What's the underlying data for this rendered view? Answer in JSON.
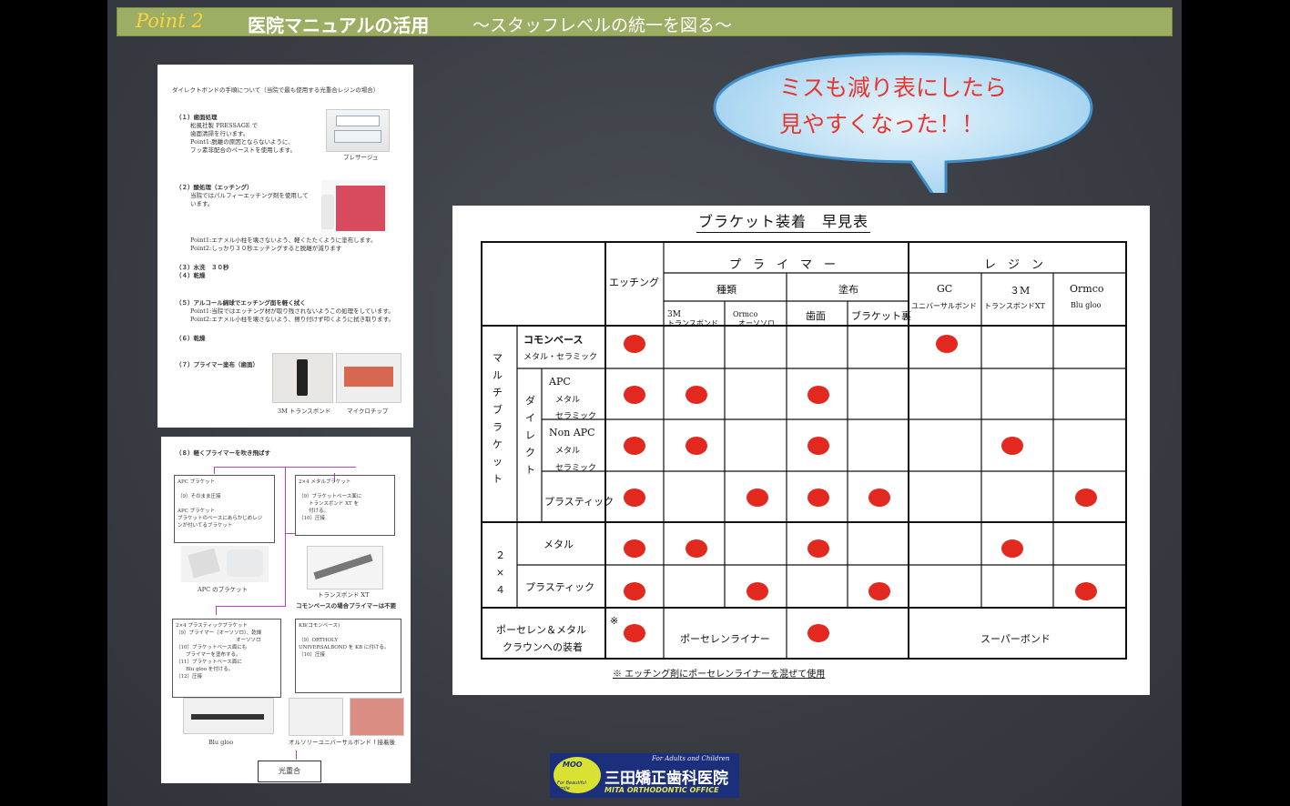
{
  "header": {
    "point": "Point 2",
    "title": "医院マニュアルの活用",
    "subtitle": "〜スタッフレベルの統一を図る〜"
  },
  "bubble": {
    "line1": "ミスも減り表にしたら",
    "line2": "見やすくなった！！"
  },
  "doc1": {
    "intro": "ダイレクトボンドの手順について（当院で最も使用する光重合レジンの場合）",
    "s1_title": "（１）歯面処理",
    "s1_body": "松風社製 PRESSAGE で\n歯面清掃を行います。\nPoint1:脱離の原因とならないように、\nフッ素非配合のペーストを使用します。",
    "s1_caption": "プレサージュ",
    "s2_title": "（２）酸処理（エッチング）",
    "s2_body": "当院ではパルフィーエッチング剤を使用して\nいます。",
    "s2_points": "Point1:エナメル小柱を壊さないよう、軽くたたくように塗布します。\nPoint2:しっかり３０秒エッチングすると脱離が減ります",
    "s3": "（３）水洗　３０秒\n（４）乾燥",
    "s5_title": "（５）アルコール綿球でエッチング面を軽く拭く",
    "s5_body": "Point1:当院ではエッチング材が取り残されないようこの処理をしています。\nPoint2:エナメル小柱を壊さないよう、擦り付けず叩くように拭き取ります。",
    "s6": "（６）乾燥",
    "s7": "（７）プライマー塗布（歯面）",
    "cap_a": "3M トランスボンド",
    "cap_b": "マイクロチップ"
  },
  "doc2": {
    "title": "（８）軽くプライマーを吹き飛ばす",
    "boxA": "APC ブラケット\n\n（9）そのまま圧接\n\nAPC ブラケット\nブラケットのベースにあらかじめレジ\nンが付いてるブラケット",
    "boxB": "2×4 メタルブラケット\n\n（9）ブラケットベース面に\n　　トランスボンド XT を\n　　付ける。\n（10）圧接",
    "capApc": "APC のブラケット",
    "capXt": "トランスボンド XT",
    "note": "コモンベースの場合プライマーは不要",
    "boxC": "2×4 プラスティックブラケット\n（9）プライマー（オーソソロ）、乾燥\n　　　　　　　　　　　　オーソソロ\n（10）ブラケットベース面にも\n　　プライマーを塗布する。\n（11）ブラケットベース面に\n　　Blu gloo を付ける。\n（12）圧接",
    "boxD": "KB(コモンベース)\n\n（9）ORTHOLY\nUNIVERSALBOND を KB に付ける。\n（10）圧接",
    "capBlu": "Blu gloo",
    "capOrt": "オルソリーユニバーサルボンド",
    "capTooth": "↑接着後",
    "final": "光重合"
  },
  "sheet": {
    "title": "ブラケット装着　早見表",
    "h_etch": "エッチング",
    "h_primer": "プ　ラ　イ　マ　ー",
    "h_resin": "レ　ジ　ン",
    "h_kind": "種類",
    "h_apply": "塗布",
    "h_3m": "3M",
    "h_3m_sub": "トランスボンド",
    "h_ormco": "Ormco",
    "h_ormco_sub": "オーソソロ",
    "h_tooth": "歯面",
    "h_back": "ブラケット裏",
    "h_gc": "GC",
    "h_gc_sub": "ユニバーサルボンド",
    "h_r3m": "３M",
    "h_r3m_sub": "トランスボンドXT",
    "h_rormco": "Ormco",
    "h_rormco_sub": "Blu gloo",
    "g_multi": "マ\nル\nチ\nブ\nラ\nケ\nッ\nト",
    "g_direct": "ダ\nイ\nレ\nク\nト",
    "g_2x4": "２\n×\n４",
    "r_common": "コモンベース",
    "r_common_sub": "メタル・セラミック",
    "r_apc": "APC",
    "r_apc_sub1": "メタル",
    "r_apc_sub2": "セラミック",
    "r_nonapc": "Non APC",
    "r_nonapc_sub1": "メタル",
    "r_nonapc_sub2": "セラミック",
    "r_plastic": "プラスティック",
    "r_metal2": "メタル",
    "r_plastic2": "プラスティック",
    "r_porc1": "ポーセレン＆メタル",
    "r_porc2": "クラウンへの装着",
    "porc_note": "※",
    "porc_liner": "ポーセレンライナー",
    "porc_super": "スーパーボンド",
    "footnote": "※ エッチング剤にポーセレンライナーを混ぜて使用",
    "marks": [
      [
        1,
        0,
        0,
        0,
        0,
        1,
        0,
        0
      ],
      [
        1,
        1,
        0,
        1,
        0,
        0,
        0,
        0
      ],
      [
        1,
        1,
        0,
        1,
        0,
        0,
        1,
        0
      ],
      [
        1,
        0,
        1,
        1,
        1,
        0,
        0,
        1
      ],
      [
        1,
        1,
        0,
        1,
        0,
        0,
        1,
        0
      ],
      [
        1,
        0,
        1,
        0,
        1,
        0,
        0,
        1
      ],
      [
        1,
        0,
        0,
        1,
        0,
        0,
        0,
        0
      ]
    ]
  },
  "logo": {
    "line1": "For Adults and Children",
    "name": "三田矯正歯科医院",
    "en": "MITA ORTHODONTIC OFFICE",
    "moo": "MOO",
    "tag": "For Beautiful Smile"
  },
  "colors": {
    "mark": "#e3281f",
    "header_bg": "#9cae63",
    "point": "#ffd23d",
    "bubble_text": "#e7362f",
    "logo_bg": "#1c2f7c"
  }
}
